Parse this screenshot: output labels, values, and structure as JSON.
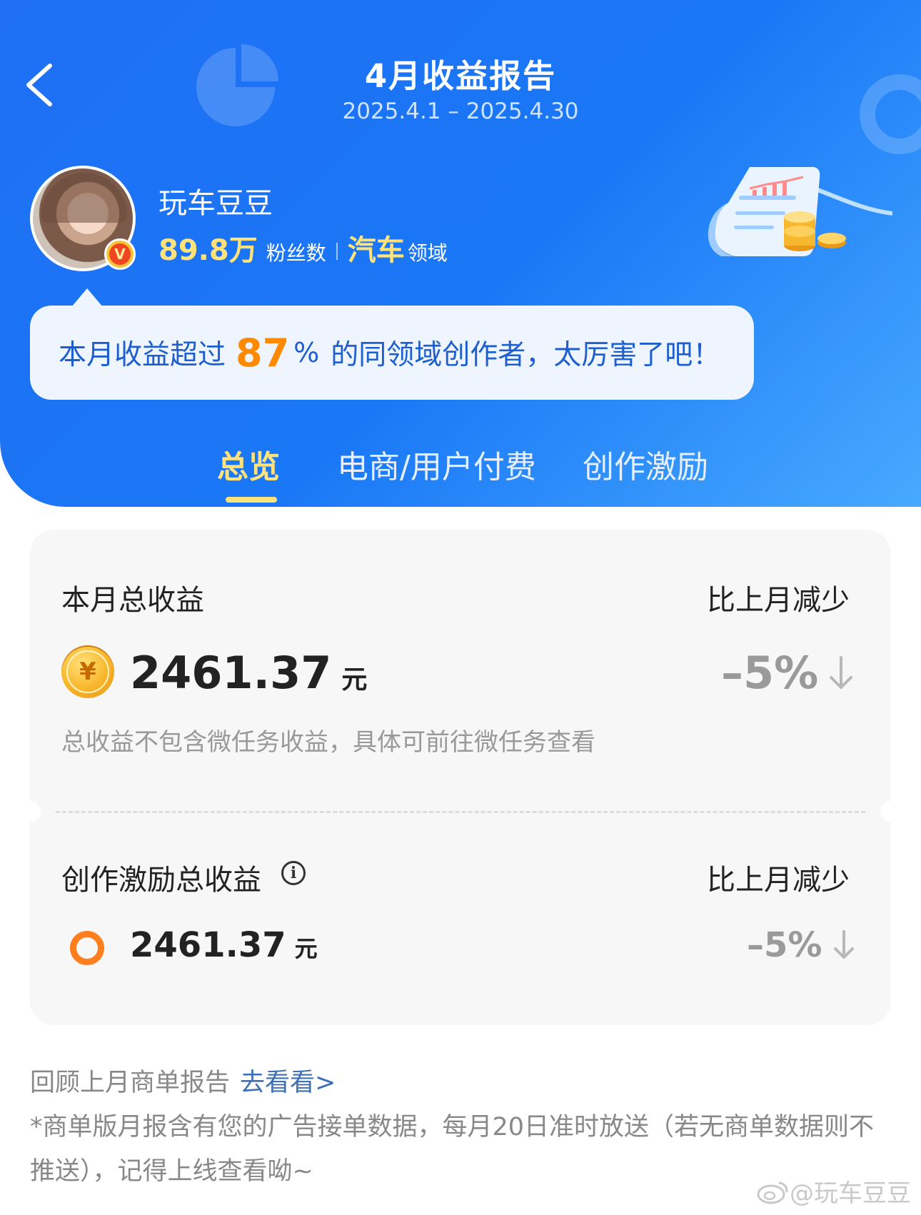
{
  "header": {
    "title": "4月收益报告",
    "date_range": "2025.4.1 – 2025.4.30"
  },
  "profile": {
    "name": "玩车豆豆",
    "fans_count": "89.8万",
    "fans_label": "粉丝数",
    "domain": "汽车",
    "domain_label": "领域",
    "badge": "V"
  },
  "bubble": {
    "prefix": "本月收益超过",
    "percent": "87",
    "percent_sign": "%",
    "suffix": "的同领域创作者，太厉害了吧！"
  },
  "tabs": [
    {
      "label": "总览",
      "active": true
    },
    {
      "label": "电商/用户付费",
      "active": false
    },
    {
      "label": "创作激励",
      "active": false
    }
  ],
  "total": {
    "label": "本月总收益",
    "compare_label": "比上月减少",
    "coin_symbol": "¥",
    "amount": "2461.37",
    "unit": "元",
    "change": "–5%",
    "note": "总收益不包含微任务收益，具体可前往微任务查看"
  },
  "incentive": {
    "label": "创作激励总收益",
    "info_symbol": "i",
    "compare_label": "比上月减少",
    "amount": "2461.37",
    "unit": "元",
    "change": "–5%"
  },
  "footer": {
    "review_text": "回顾上月商单报告",
    "review_link": "去看看>",
    "footnote": "*商单版月报含有您的广告接单数据，每月20日准时放送（若无商单数据则不推送），记得上线查看呦~",
    "watermark": "@玩车豆豆"
  },
  "colors": {
    "header_blue": "#1f6ff4",
    "accent_yellow": "#ffe27a",
    "accent_orange": "#ff8a00",
    "bubble_text": "#1e5fcf",
    "change_gray": "#9a9a9a"
  }
}
